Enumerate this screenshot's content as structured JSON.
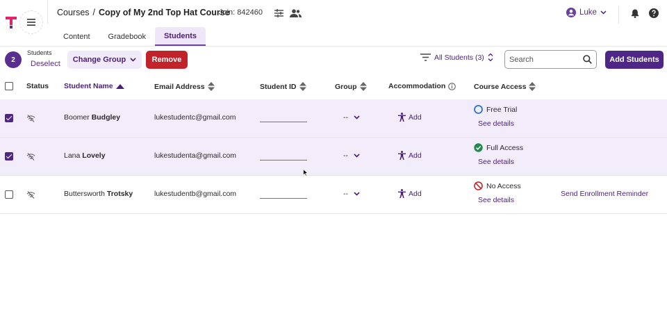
{
  "header": {
    "breadcrumb_root": "Courses",
    "breadcrumb_sep": "/",
    "course_title": "Copy of My 2nd Top Hat Course",
    "join_code": "Join: 842460",
    "user_name": "Luke"
  },
  "tabs": [
    {
      "label": "Content",
      "active": false
    },
    {
      "label": "Gradebook",
      "active": false
    },
    {
      "label": "Students",
      "active": true
    }
  ],
  "toolbar": {
    "selected_count": "2",
    "selected_label": "Students",
    "deselect": "Deselect",
    "change_group": "Change Group",
    "remove": "Remove",
    "filter": "All Students (3)",
    "search_placeholder": "Search",
    "add_students": "Add Students"
  },
  "table": {
    "headers": {
      "status": "Status",
      "student_name": "Student Name",
      "email": "Email Address",
      "student_id": "Student ID",
      "group": "Group",
      "accommodation": "Accommodation",
      "course_access": "Course Access"
    },
    "rows": [
      {
        "first_name": "Boomer",
        "last_name": "Budgley",
        "email": "lukestudentc@gmail.com",
        "group": "--",
        "accommodation": "Add",
        "access": "Free Trial",
        "access_state": "trial",
        "details": "See details",
        "reminder": "",
        "selected": true
      },
      {
        "first_name": "Lana",
        "last_name": "Lovely",
        "email": "lukestudenta@gmail.com",
        "group": "--",
        "accommodation": "Add",
        "access": "Full Access",
        "access_state": "full",
        "details": "See details",
        "reminder": "",
        "selected": true
      },
      {
        "first_name": "Buttersworth",
        "last_name": "Trotsky",
        "email": "lukestudentb@gmail.com",
        "group": "--",
        "accommodation": "Add",
        "access": "No Access",
        "access_state": "none",
        "details": "See details",
        "reminder": "Send Enrollment Reminder",
        "selected": false
      }
    ]
  },
  "colors": {
    "brand": "#4e2685",
    "accent_text": "#4a1f7a",
    "danger": "#c0242a",
    "selected_row": "#f3ecfb",
    "trial": "#2c6fd1",
    "full": "#1f8a4c",
    "none": "#c0242a"
  },
  "icons": {
    "logo": "top-hat-logo",
    "menu": "hamburger-icon",
    "settings": "sliders-icon",
    "people": "people-icon",
    "user": "user-circle-icon",
    "bell": "bell-icon",
    "help": "help-icon",
    "filter": "filter-icon",
    "search": "search-icon",
    "status": "offline-icon",
    "accommodation": "accessibility-icon"
  }
}
